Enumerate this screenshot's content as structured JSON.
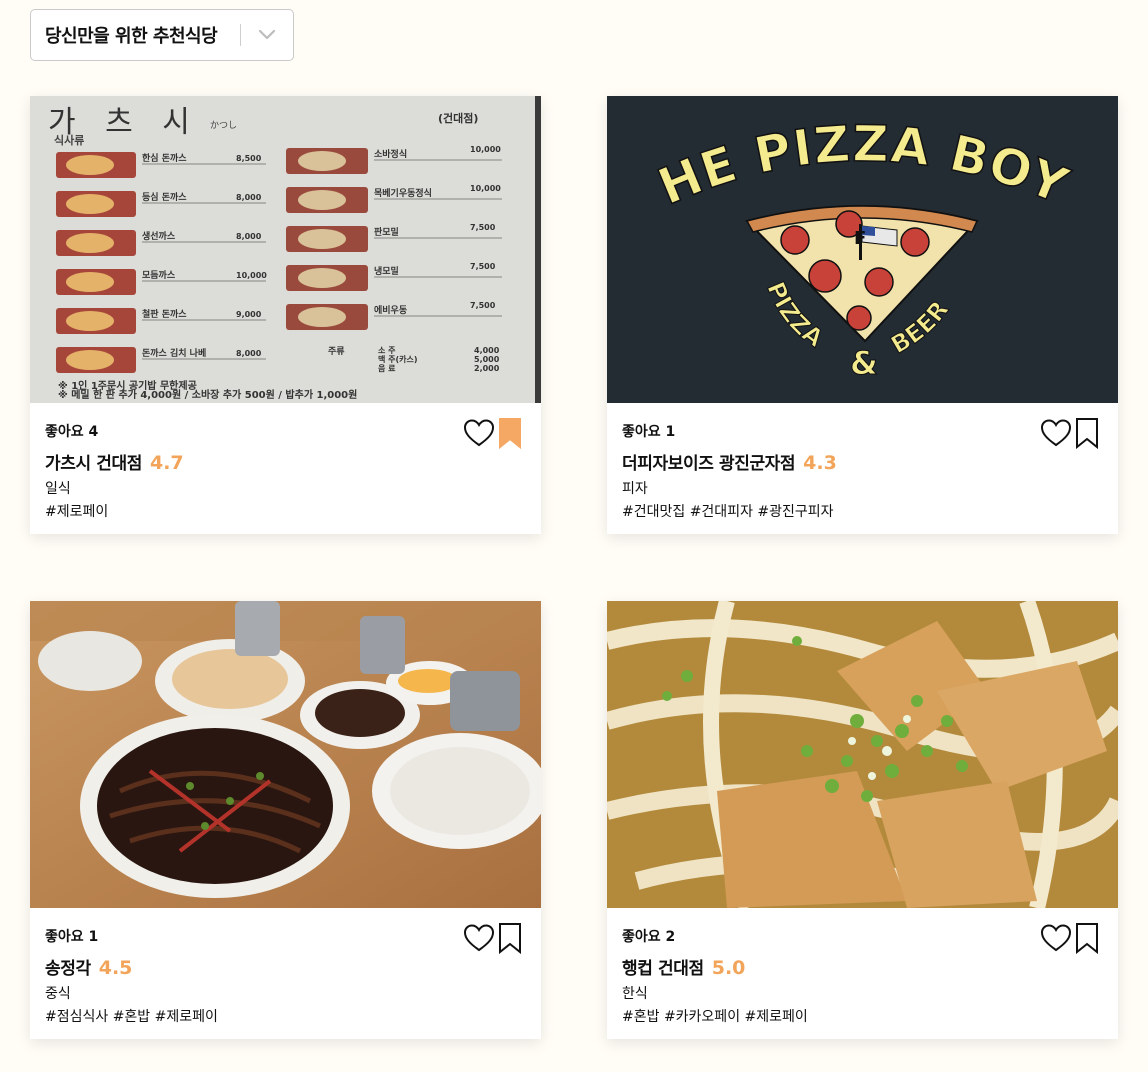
{
  "filter": {
    "label": "당신만을 위한 추천식당",
    "icon": "chevron-down-icon"
  },
  "colors": {
    "rating": "#f2a55a",
    "bookmark_active": "#f5a864",
    "background": "#fffdf6"
  },
  "restaurants": [
    {
      "likes": "좋아요 4",
      "name": "가츠시 건대점",
      "rating": "4.7",
      "category": "일식",
      "tags": "#제로페이",
      "bookmarked": true,
      "photo": "menu-board-photo",
      "photo_text": {
        "title": "가 츠 시",
        "sub": "かつし",
        "branch": "(건대점)",
        "section": "식사류",
        "footer1": "※ 1인 1주문시 공기밥 무한제공",
        "footer2": "※ 메밀 한 판 추가 4,000원 / 소바장 추가 500원 / 밥추가 1,000원",
        "left_items": [
          {
            "name": "한심 돈까스",
            "price": "8,500"
          },
          {
            "name": "등심 돈까스",
            "price": "8,000"
          },
          {
            "name": "생선까스",
            "price": "8,000"
          },
          {
            "name": "모듬까스",
            "price": "10,000"
          },
          {
            "name": "철판 돈까스",
            "price": "9,000"
          },
          {
            "name": "돈까스 김치 나베",
            "price": "8,000"
          }
        ],
        "right_items": [
          {
            "name": "소바정식",
            "price": "10,000"
          },
          {
            "name": "목베기우동정식",
            "price": "10,000"
          },
          {
            "name": "판모밀",
            "price": "7,500"
          },
          {
            "name": "냉모밀",
            "price": "7,500"
          },
          {
            "name": "에비우동",
            "price": "7,500"
          }
        ],
        "drinks_label": "주류",
        "drinks": [
          {
            "name": "소 주",
            "price": "4,000"
          },
          {
            "name": "맥 주(카스)",
            "price": "5,000"
          },
          {
            "name": "음 료",
            "price": "2,000"
          }
        ]
      }
    },
    {
      "likes": "좋아요 1",
      "name": "더피자보이즈 광진군자점",
      "rating": "4.3",
      "category": "피자",
      "tags": "#건대맛집 #건대피자 #광진구피자",
      "bookmarked": false,
      "photo": "pizza-logo",
      "photo_text": {
        "brand": "THE PIZZA BOYZ",
        "left_word": "PIZZA",
        "amp": "&",
        "right_word": "BEER",
        "flag_letter": "F"
      }
    },
    {
      "likes": "좋아요 1",
      "name": "송정각",
      "rating": "4.5",
      "category": "중식",
      "tags": "#점심식사 #혼밥 #제로페이",
      "bookmarked": false,
      "photo": "jjajang-food-photo"
    },
    {
      "likes": "좋아요 2",
      "name": "행컵 건대점",
      "rating": "5.0",
      "category": "한식",
      "tags": "#혼밥 #카카오페이 #제로페이",
      "bookmarked": false,
      "photo": "udon-food-photo"
    }
  ]
}
